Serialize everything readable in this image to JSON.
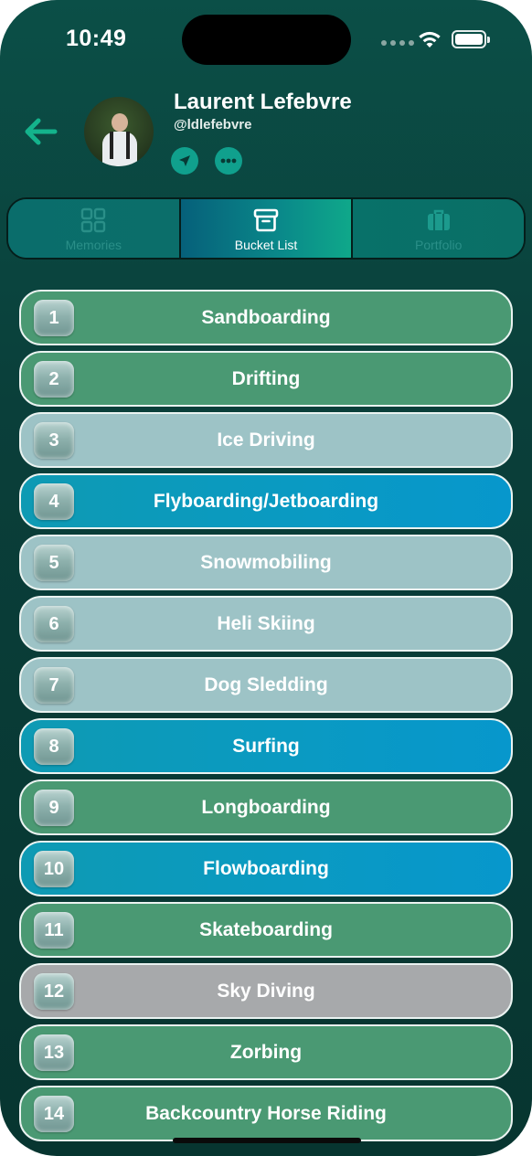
{
  "status": {
    "time": "10:49"
  },
  "profile": {
    "name": "Laurent Lefebvre",
    "handle": "@ldlefebvre"
  },
  "tabs": [
    {
      "label": "Memories",
      "icon": "grid-icon",
      "active": false
    },
    {
      "label": "Bucket List",
      "icon": "archive-box-icon",
      "active": true
    },
    {
      "label": "Portfolio",
      "icon": "briefcase-icon",
      "active": false
    }
  ],
  "bucket_list": [
    {
      "number": "1",
      "label": "Sandboarding",
      "style": "green"
    },
    {
      "number": "2",
      "label": "Drifting",
      "style": "green"
    },
    {
      "number": "3",
      "label": "Ice Driving",
      "style": "light"
    },
    {
      "number": "4",
      "label": "Flyboarding/Jetboarding",
      "style": "blue"
    },
    {
      "number": "5",
      "label": "Snowmobiling",
      "style": "light"
    },
    {
      "number": "6",
      "label": "Heli Skiing",
      "style": "light"
    },
    {
      "number": "7",
      "label": "Dog Sledding",
      "style": "light"
    },
    {
      "number": "8",
      "label": "Surfing",
      "style": "blue"
    },
    {
      "number": "9",
      "label": "Longboarding",
      "style": "green"
    },
    {
      "number": "10",
      "label": "Flowboarding",
      "style": "blue"
    },
    {
      "number": "11",
      "label": "Skateboarding",
      "style": "green"
    },
    {
      "number": "12",
      "label": "Sky Diving",
      "style": "grey"
    },
    {
      "number": "13",
      "label": "Zorbing",
      "style": "green"
    },
    {
      "number": "14",
      "label": "Backcountry Horse Riding",
      "style": "green"
    }
  ],
  "colors": {
    "background": "#0a3f3a",
    "accent": "#10a08d",
    "green_item": "#4a9973",
    "light_item": "#9dc3c6",
    "blue_item": "#0797cc",
    "grey_item": "#a7a9ab"
  }
}
